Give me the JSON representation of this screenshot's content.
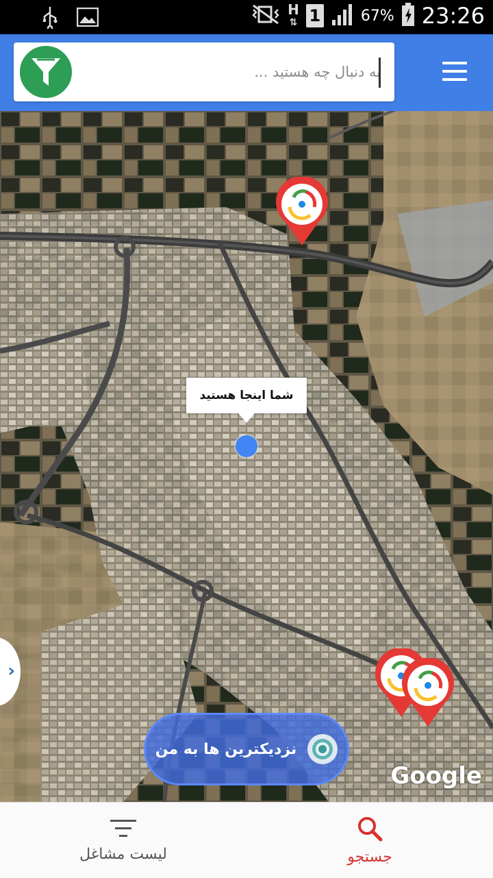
{
  "status_bar": {
    "battery_percent": "67%",
    "time": "23:26",
    "sim_slot": "1",
    "network_type": "H",
    "icons": [
      "usb-icon",
      "image-icon",
      "mute-vibrate-icon",
      "network-h-icon",
      "sim-1-icon",
      "signal-icon",
      "battery-charging-icon"
    ]
  },
  "header": {
    "search_placeholder": "به دنبال چه هستید ...",
    "filter_icon": "funnel-icon",
    "menu_icon": "hamburger-menu-icon",
    "accent_color": "#3f7fe6",
    "filter_color": "#2e9e55"
  },
  "map": {
    "you_are_here": "شما اینجا هستید",
    "nearby_button": "نزدیکترین ها به من",
    "attribution": "Google",
    "pin_color": "#e53935",
    "location_dot_color": "#4285f4"
  },
  "bottom_nav": {
    "items": [
      {
        "label": "لیست مشاغل",
        "icon": "list-filter-icon",
        "active": false
      },
      {
        "label": "جستجو",
        "icon": "search-icon",
        "active": true
      }
    ],
    "active_color": "#d8302e"
  }
}
